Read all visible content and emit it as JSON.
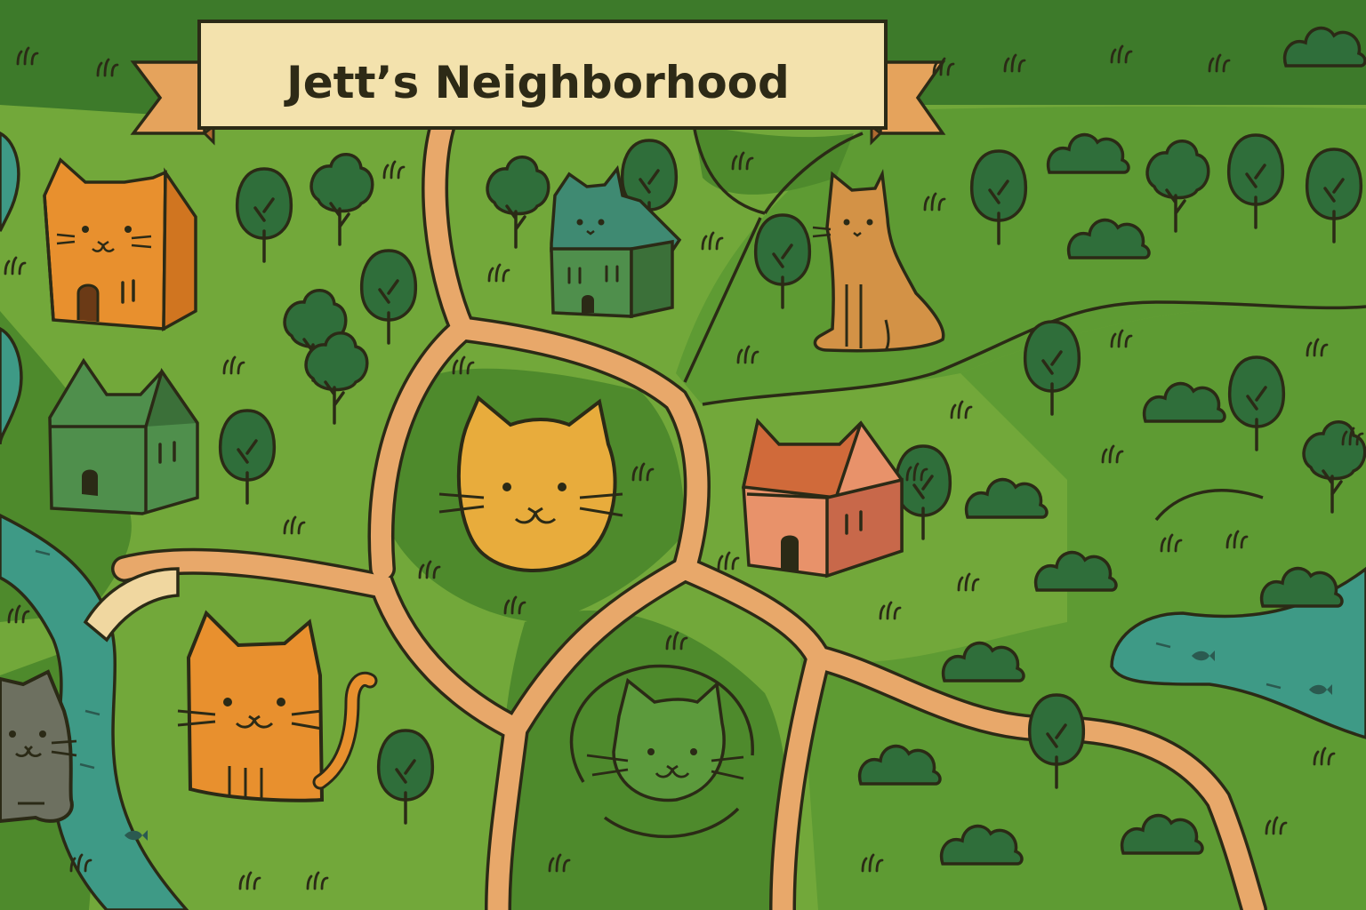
{
  "map": {
    "title": "Jett’s Neighborhood"
  },
  "colors": {
    "grass_light": "#72a83a",
    "grass_dark": "#4e8a2c",
    "grass_top": "#3d7a2a",
    "road": "#e8a86a",
    "river": "#3e9a86",
    "tree": "#2f6e3a",
    "outline": "#2b2a16",
    "banner": "#f3e2ad",
    "ribbon": "#e5a35c",
    "cat_orange": "#e8902e",
    "cat_yellow": "#e8ac3c",
    "cat_tan": "#d39246",
    "cat_green": "#5c9a3c",
    "cat_gray": "#6d7060",
    "house_green": "#4f8f4c",
    "house_teal": "#3f8a72",
    "house_rust": "#d06a3a"
  },
  "icons": [
    "cat-house-icon",
    "green-house-icon",
    "teal-cat-house-icon",
    "brick-house-icon",
    "sitting-cat-icon",
    "cat-face-icon",
    "tree-icon",
    "bush-icon",
    "fish-icon",
    "bridge-icon"
  ]
}
